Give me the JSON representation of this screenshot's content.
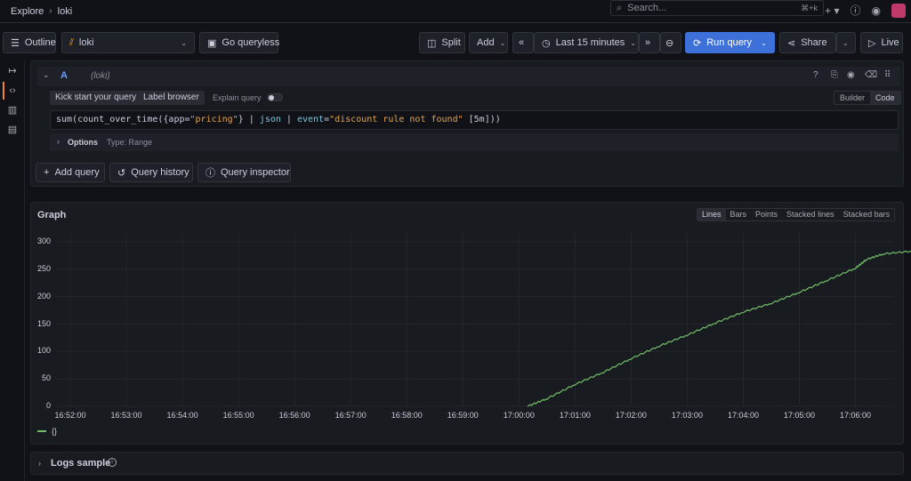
{
  "breadcrumb": {
    "root": "Explore",
    "current": "loki"
  },
  "search": {
    "placeholder": "Search...",
    "shortcut": "⌘+k"
  },
  "toolbar": {
    "outline": "Outline",
    "datasource": "loki",
    "go_queryless": "Go queryless",
    "split": "Split",
    "add": "Add",
    "time_range": "Last 15 minutes",
    "run_query": "Run query",
    "share": "Share",
    "live": "Live"
  },
  "query": {
    "ref": "A",
    "datasource": "(loki)",
    "kick_start": "Kick start your query",
    "label_browser": "Label browser",
    "explain": "Explain query",
    "mode_builder": "Builder",
    "mode_code": "Code",
    "expr_parts": [
      "sum(count_over_time({app=",
      "\"pricing\"",
      "} | ",
      "json",
      " | ",
      "event",
      "=",
      "\"discount rule not found\"",
      " [5m]))"
    ],
    "options_label": "Options",
    "options_type": "Type: Range"
  },
  "actions": {
    "add_query": "Add query",
    "query_history": "Query history",
    "query_inspector": "Query inspector"
  },
  "graph": {
    "title": "Graph",
    "modes": [
      "Lines",
      "Bars",
      "Points",
      "Stacked lines",
      "Stacked bars"
    ],
    "active_mode": "Lines",
    "legend": "{}",
    "color": "#73bf69"
  },
  "logs": {
    "title": "Logs sample"
  },
  "chart_data": {
    "type": "line",
    "ylim": [
      0,
      300
    ],
    "yticks": [
      0,
      50,
      100,
      150,
      200,
      250,
      300
    ],
    "xticks": [
      "16:52:00",
      "16:53:00",
      "16:54:00",
      "16:55:00",
      "16:56:00",
      "16:57:00",
      "16:58:00",
      "16:59:00",
      "17:00:00",
      "17:01:00",
      "17:02:00",
      "17:03:00",
      "17:04:00",
      "17:05:00",
      "17:06:00"
    ],
    "x_minutes_since_1652": [
      8.15,
      8.5,
      9.0,
      9.5,
      10.0,
      10.5,
      11.0,
      11.5,
      12.0,
      12.5,
      13.0,
      13.5,
      14.0,
      14.2,
      14.5,
      15.0,
      15.5,
      15.8
    ],
    "series": [
      {
        "name": "{}",
        "values": [
          0,
          14,
          40,
          62,
          87,
          110,
          130,
          152,
          172,
          188,
          208,
          230,
          252,
          268,
          278,
          283,
          276,
          265
        ]
      }
    ]
  }
}
